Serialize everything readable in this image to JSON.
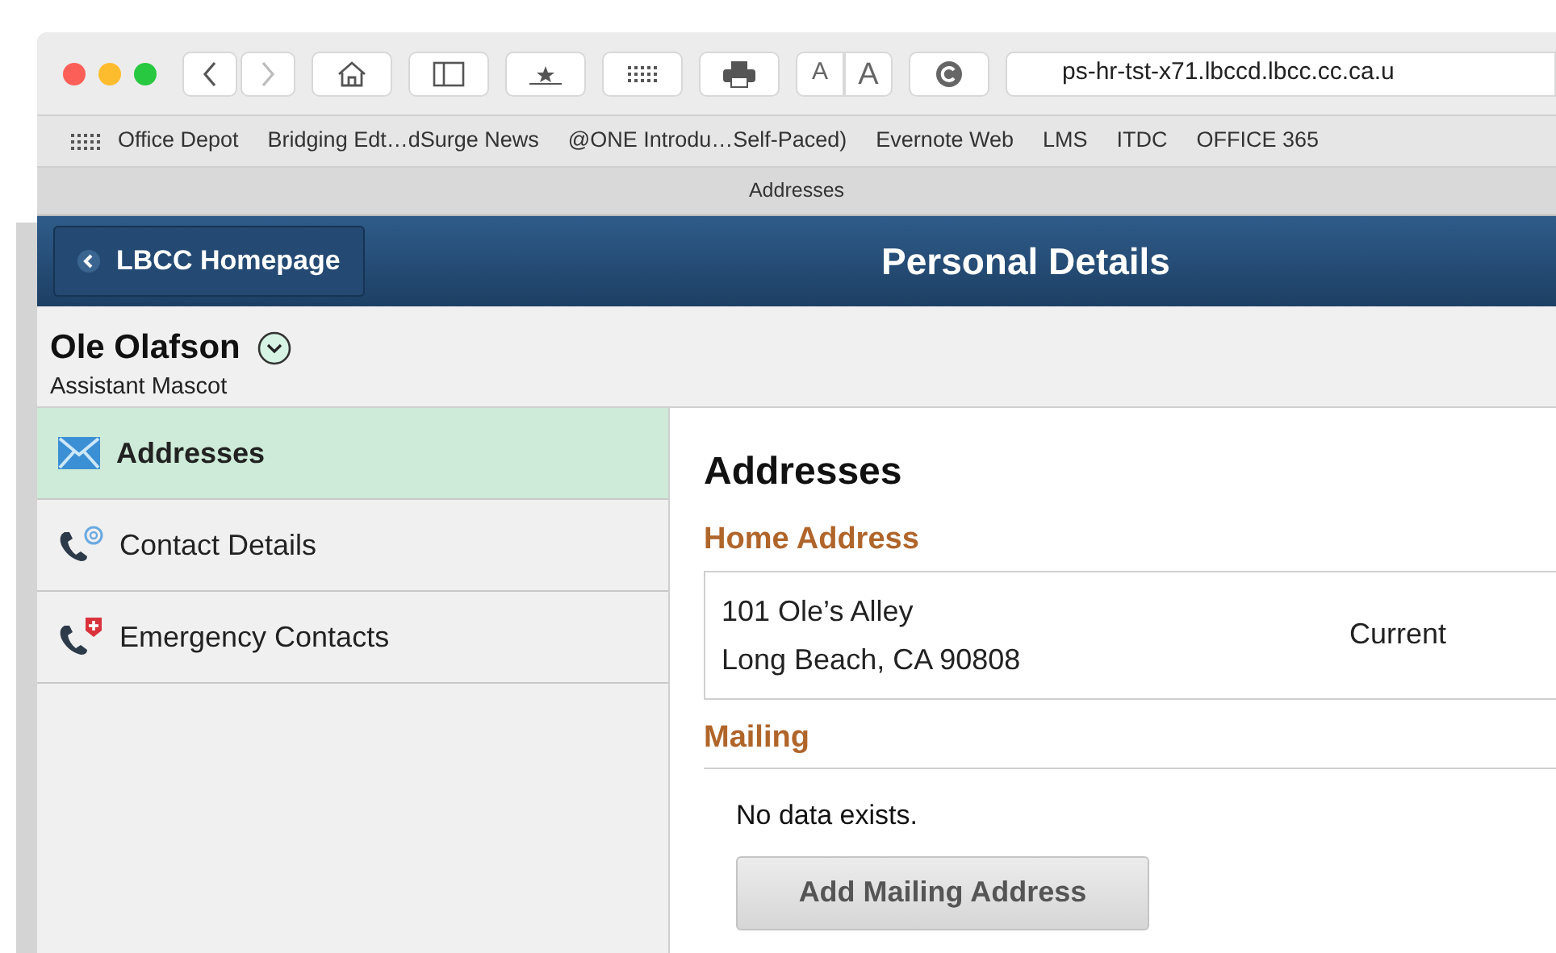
{
  "browser": {
    "font_buttons": [
      "A",
      "A"
    ],
    "url": "ps-hr-tst-x71.lbccd.lbcc.cc.ca.u",
    "bookmarks": [
      "Office Depot",
      "Bridging Edt…dSurge News",
      "@ONE Introdu…Self-Paced)",
      "Evernote Web",
      "LMS",
      "ITDC",
      "OFFICE 365"
    ],
    "tab_title": "Addresses"
  },
  "header": {
    "back_button": "LBCC Homepage",
    "title": "Personal Details"
  },
  "person": {
    "name": "Ole Olafson",
    "job_title": "Assistant Mascot"
  },
  "sidebar": {
    "items": [
      {
        "kind": "mail",
        "label": "Addresses",
        "selected": true
      },
      {
        "kind": "contact",
        "label": "Contact Details",
        "selected": false
      },
      {
        "kind": "emergency",
        "label": "Emergency Contacts",
        "selected": false
      }
    ]
  },
  "content": {
    "title": "Addresses",
    "sections": [
      {
        "kind": "address",
        "heading": "Home Address",
        "lines": [
          "101 Ole’s Alley",
          "Long Beach, CA 90808"
        ],
        "status": "Current"
      },
      {
        "kind": "empty",
        "heading": "Mailing",
        "message": "No data exists.",
        "button": "Add Mailing Address"
      }
    ]
  }
}
